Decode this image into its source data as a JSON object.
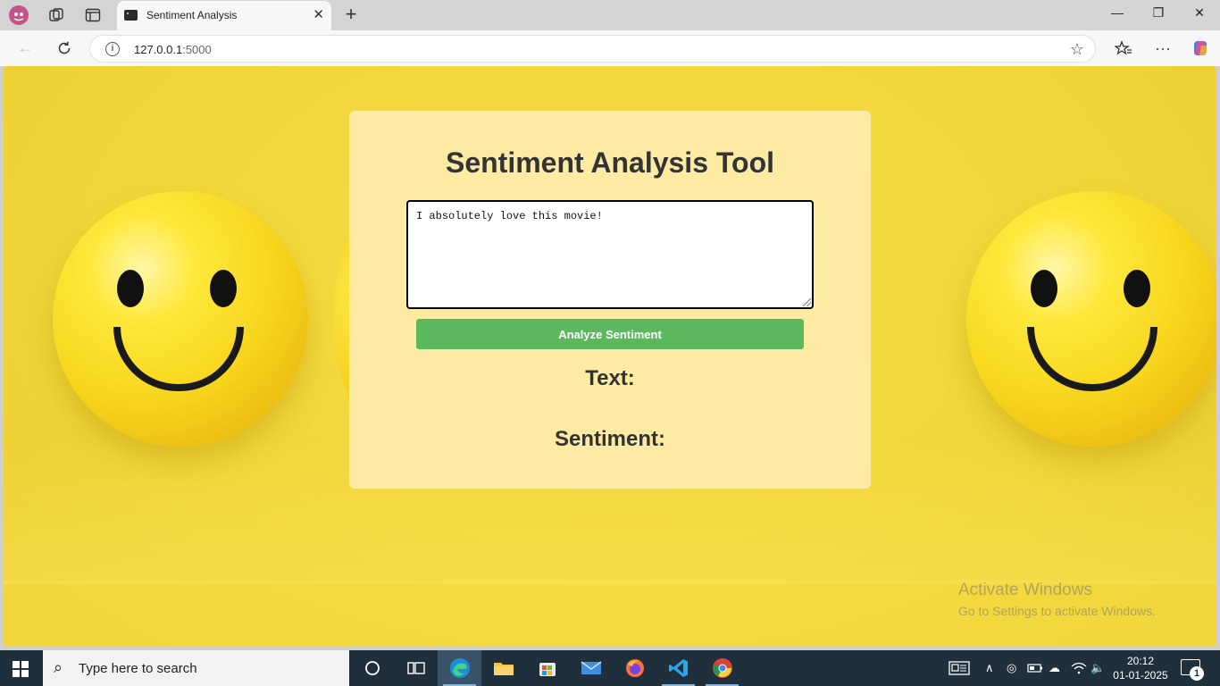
{
  "browser": {
    "tab_title": "Sentiment Analysis",
    "url_host": "127.0.0.1",
    "url_port": ":5000"
  },
  "page": {
    "heading": "Sentiment Analysis Tool",
    "input_text": "I absolutely love this movie!",
    "analyze_label": "Analyze Sentiment",
    "text_label": "Text:",
    "sentiment_label": "Sentiment:"
  },
  "watermark": {
    "line1": "Activate Windows",
    "line2": "Go to Settings to activate Windows."
  },
  "taskbar": {
    "search_placeholder": "Type here to search",
    "time": "20:12",
    "date": "01-01-2025",
    "notification_count": "1"
  },
  "colors": {
    "card_bg": "#fdeba3",
    "button_bg": "#5cb85c",
    "page_bg": "#f1d638"
  }
}
